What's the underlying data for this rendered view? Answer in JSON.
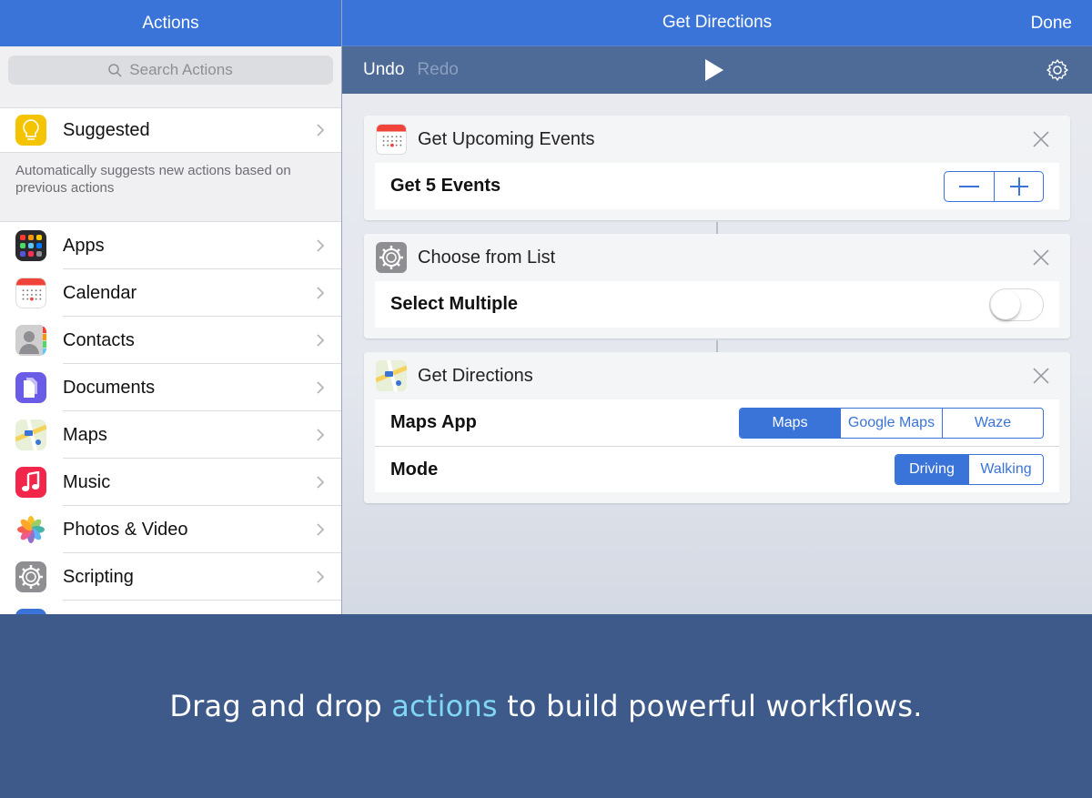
{
  "left": {
    "title": "Actions",
    "search_placeholder": "Search Actions",
    "suggested": {
      "label": "Suggested",
      "note": "Automatically suggests new actions based on previous actions"
    },
    "categories": [
      {
        "label": "Apps",
        "icon": "apps-icon"
      },
      {
        "label": "Calendar",
        "icon": "calendar-icon"
      },
      {
        "label": "Contacts",
        "icon": "contacts-icon"
      },
      {
        "label": "Documents",
        "icon": "documents-icon"
      },
      {
        "label": "Maps",
        "icon": "maps-icon"
      },
      {
        "label": "Music",
        "icon": "music-icon"
      },
      {
        "label": "Photos & Video",
        "icon": "photos-icon"
      },
      {
        "label": "Scripting",
        "icon": "scripting-icon"
      }
    ]
  },
  "right": {
    "title": "Get Directions",
    "done_label": "Done",
    "undo_label": "Undo",
    "redo_label": "Redo",
    "actions": [
      {
        "title": "Get Upcoming Events",
        "params": [
          {
            "label": "Get 5 Events",
            "control": "stepper"
          }
        ]
      },
      {
        "title": "Choose from List",
        "params": [
          {
            "label": "Select Multiple",
            "control": "toggle",
            "value": false
          }
        ]
      },
      {
        "title": "Get Directions",
        "params": [
          {
            "label": "Maps App",
            "control": "segmented",
            "options": [
              "Maps",
              "Google Maps",
              "Waze"
            ],
            "selected": "Maps"
          },
          {
            "label": "Mode",
            "control": "segmented",
            "options": [
              "Driving",
              "Walking"
            ],
            "selected": "Driving"
          }
        ]
      }
    ]
  },
  "banner": {
    "text_before": "Drag and drop ",
    "highlight": "actions",
    "text_after": " to build powerful workflows."
  },
  "colors": {
    "accent": "#3a74d8",
    "toolbar": "#4d6b96",
    "banner": "#3d5a8a",
    "highlight": "#7fd7f5"
  }
}
